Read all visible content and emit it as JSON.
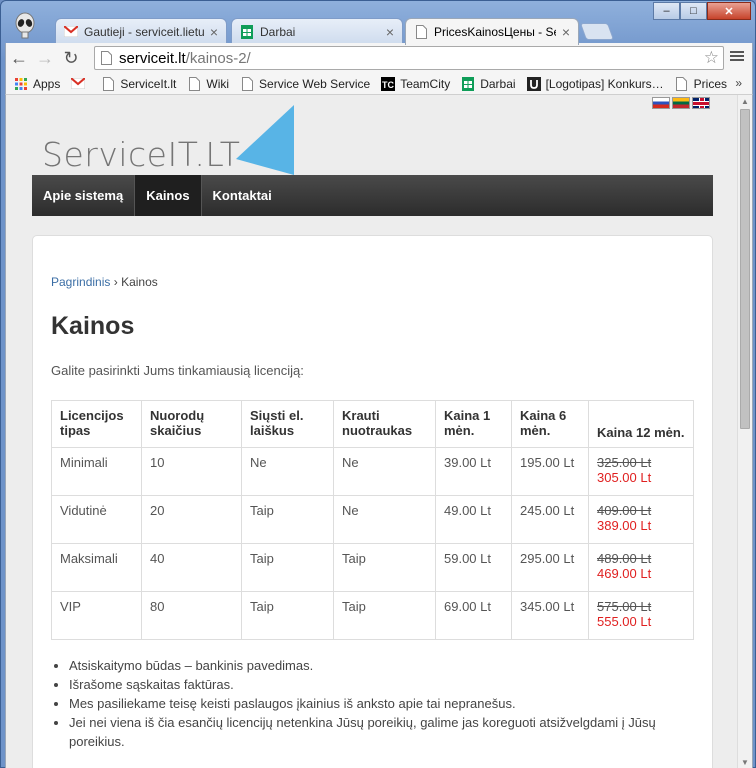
{
  "browser": {
    "tabs": [
      {
        "label": "Gautieji - serviceit.lietuva@",
        "icon": "gmail-icon"
      },
      {
        "label": "Darbai",
        "icon": "sheets-icon"
      },
      {
        "label": "PricesKainosЦены - Servic",
        "icon": "page-icon",
        "active": true
      }
    ],
    "tab_close": "×",
    "window_buttons": {
      "minimize": "–",
      "maximize": "□",
      "close": "✕"
    },
    "url": {
      "domain": "serviceit.lt",
      "path": "/kainos-2/"
    },
    "bookmarks": [
      {
        "label": "Apps",
        "icon": "apps-grid-icon"
      },
      {
        "label": "",
        "icon": "gmail-icon"
      },
      {
        "label": "ServiceIt.lt",
        "icon": "page-icon"
      },
      {
        "label": "Wiki",
        "icon": "page-icon"
      },
      {
        "label": "Service Web Service",
        "icon": "page-icon"
      },
      {
        "label": "TeamCity",
        "icon": "teamcity-icon"
      },
      {
        "label": "Darbai",
        "icon": "sheets-icon"
      },
      {
        "label": "[Logotipas] Konkurs…",
        "icon": "upwork-icon"
      },
      {
        "label": "Prices",
        "icon": "page-icon"
      }
    ],
    "bookmarks_more": "»"
  },
  "site": {
    "logo_text": "ServiceIT.LT",
    "nav": [
      {
        "label": "Apie sistemą",
        "active": false
      },
      {
        "label": "Kainos",
        "active": true
      },
      {
        "label": "Kontaktai",
        "active": false
      }
    ],
    "breadcrumb": {
      "home": "Pagrindinis",
      "sep": "›",
      "current": "Kainos"
    },
    "title": "Kainos",
    "intro": "Galite pasirinkti Jums tinkamiausią licenciją:",
    "table": {
      "headers": [
        "Licencijos tipas",
        "Nuorodų skaičius",
        "Siųsti el. laiškus",
        "Krauti nuotraukas",
        "Kaina 1 mėn.",
        "Kaina 6 mėn.",
        "Kaina 12 mėn."
      ],
      "rows": [
        {
          "type": "Minimali",
          "links": "10",
          "email": "Ne",
          "photos": "Ne",
          "m1": "39.00 Lt",
          "m6": "195.00 Lt",
          "old": "325.00 Lt",
          "new": "305.00 Lt"
        },
        {
          "type": "Vidutinė",
          "links": "20",
          "email": "Taip",
          "photos": "Ne",
          "m1": "49.00 Lt",
          "m6": "245.00 Lt",
          "old": "409.00 Lt",
          "new": "389.00 Lt"
        },
        {
          "type": "Maksimali",
          "links": "40",
          "email": "Taip",
          "photos": "Taip",
          "m1": "59.00 Lt",
          "m6": "295.00 Lt",
          "old": "489.00 Lt",
          "new": "469.00 Lt"
        },
        {
          "type": "VIP",
          "links": "80",
          "email": "Taip",
          "photos": "Taip",
          "m1": "69.00 Lt",
          "m6": "345.00 Lt",
          "old": "575.00 Lt",
          "new": "555.00 Lt"
        }
      ]
    },
    "notes": [
      "Atsiskaitymo būdas – bankinis pavedimas.",
      "Išrašome sąskaitas faktūras.",
      "Mes pasiliekame teisę keisti paslaugos įkainius iš anksto apie tai nepranešus.",
      "Jei nei viena iš čia esančių licencijų netenkina Jūsų poreikių, galime jas koreguoti atsižvelgdami į Jūsų poreikius."
    ]
  }
}
